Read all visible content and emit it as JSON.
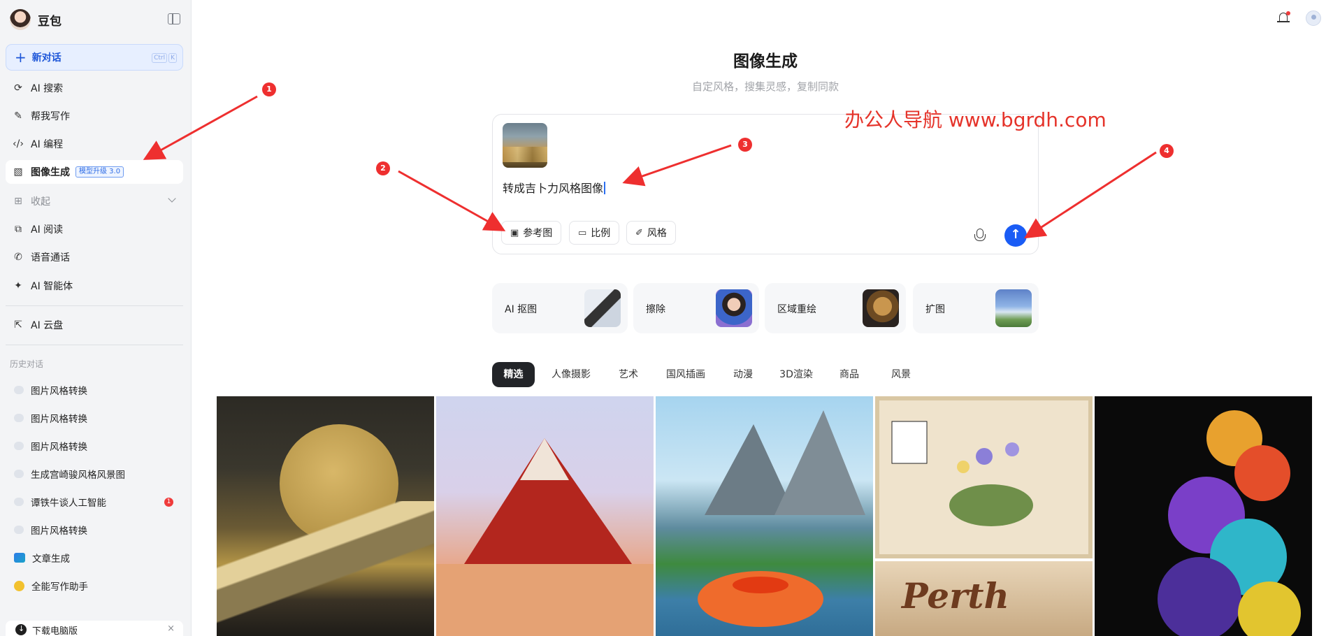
{
  "sidebar": {
    "app_name": "豆包",
    "new_chat": {
      "label": "新对话",
      "kbd": [
        "Ctrl",
        "K"
      ]
    },
    "nav": [
      {
        "label": "AI 搜索",
        "icon": "search-icon"
      },
      {
        "label": "帮我写作",
        "icon": "pen-icon"
      },
      {
        "label": "AI 编程",
        "icon": "code-icon"
      },
      {
        "label": "图像生成",
        "icon": "image-icon",
        "badge": "模型升级 3.0",
        "active": true
      },
      {
        "label": "收起",
        "icon": "apps-icon",
        "muted": true
      },
      {
        "label": "AI 阅读",
        "icon": "book-icon"
      },
      {
        "label": "语音通话",
        "icon": "phone-icon"
      },
      {
        "label": "AI 智能体",
        "icon": "sparkle-icon"
      },
      {
        "label": "AI 云盘",
        "icon": "cloud-drive-icon"
      }
    ],
    "history_label": "历史对话",
    "history": [
      {
        "label": "图片风格转换"
      },
      {
        "label": "图片风格转换"
      },
      {
        "label": "图片风格转换"
      },
      {
        "label": "生成宫崎骏风格风景图"
      },
      {
        "label": "谭铁牛谈人工智能",
        "unread": "1"
      },
      {
        "label": "图片风格转换"
      },
      {
        "label": "文章生成"
      },
      {
        "label": "全能写作助手"
      }
    ],
    "download_label": "下载电脑版"
  },
  "main": {
    "title": "图像生成",
    "subtitle": "自定风格，搜集灵感，复制同款",
    "watermark": "办公人导航  www.bgrdh.com",
    "prompt": {
      "text": "转成吉卜力风格图像",
      "chips": [
        {
          "label": "参考图",
          "icon": "image-ref-icon"
        },
        {
          "label": "比例",
          "icon": "ratio-icon"
        },
        {
          "label": "风格",
          "icon": "brush-icon"
        }
      ]
    },
    "tools": [
      {
        "label": "AI 抠图"
      },
      {
        "label": "擦除"
      },
      {
        "label": "区域重绘"
      },
      {
        "label": "扩图"
      }
    ],
    "tabs": [
      "精选",
      "人像摄影",
      "艺术",
      "国风插画",
      "动漫",
      "3D渲染",
      "商品",
      "风景"
    ],
    "gallery_text": "Perth"
  },
  "annotations": [
    "1",
    "2",
    "3",
    "4"
  ],
  "colors": {
    "accent": "#1a5cf5",
    "annotation": "#ee2f2f",
    "watermark": "#e5332a"
  }
}
